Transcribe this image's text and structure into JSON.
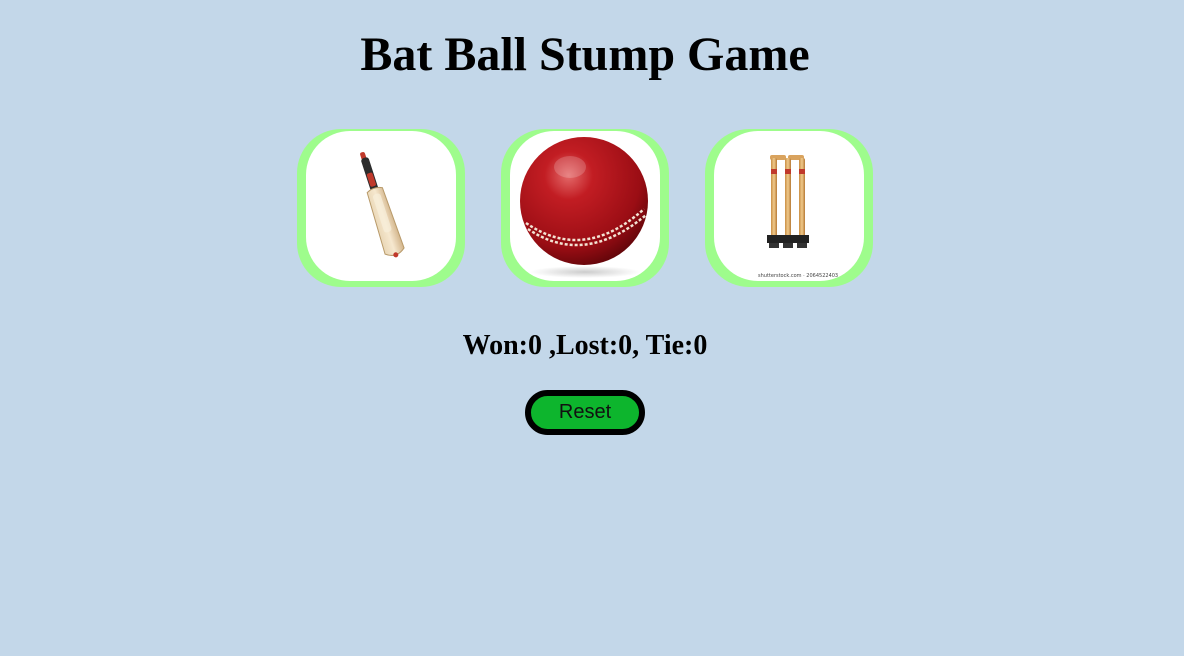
{
  "title": "Bat Ball Stump Game",
  "choices": [
    {
      "name": "Bat",
      "icon": "cricket-bat-icon"
    },
    {
      "name": "Ball",
      "icon": "cricket-ball-icon"
    },
    {
      "name": "Stump",
      "icon": "cricket-stumps-icon"
    }
  ],
  "score_text": "Won:0 ,Lost:0, Tie:0",
  "reset_label": "Reset",
  "colors": {
    "background": "#c3d7e9",
    "choice_frame": "#9efc8c",
    "reset_button": "#0db52d"
  }
}
